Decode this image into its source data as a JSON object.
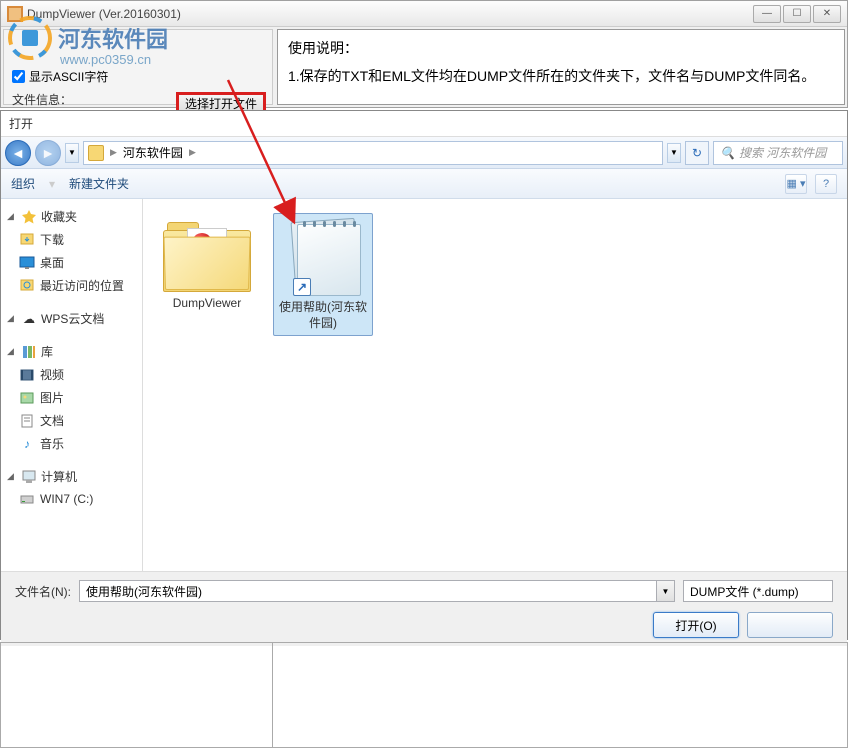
{
  "app": {
    "title": "DumpViewer (Ver.20160301)",
    "checkbox_label": "显示ASCII字符",
    "select_button": "选择打开文件",
    "file_info_label": "文件信息：",
    "instructions_title": "使用说明：",
    "instruction_1": "1.保存的TXT和EML文件均在DUMP文件所在的文件夹下，文件名与DUMP文件同名。"
  },
  "watermark": {
    "site_name": "河东软件园",
    "url": "www.pc0359.cn"
  },
  "dialog": {
    "title": "打开",
    "breadcrumb_root": "河东软件园",
    "search_placeholder": "搜索 河东软件园",
    "toolbar": {
      "organize": "组织",
      "new_folder": "新建文件夹"
    },
    "sidebar": {
      "favorites": "收藏夹",
      "downloads": "下载",
      "desktop": "桌面",
      "recent": "最近访问的位置",
      "wps": "WPS云文档",
      "libraries": "库",
      "videos": "视频",
      "pictures": "图片",
      "documents": "文档",
      "music": "音乐",
      "computer": "计算机",
      "drive_c": "WIN7 (C:)"
    },
    "files": {
      "folder_name": "DumpViewer",
      "file_name": "使用帮助(河东软件园)"
    },
    "footer": {
      "filename_label": "文件名(N):",
      "filename_value": "使用帮助(河东软件园)",
      "filter": "DUMP文件 (*.dump)",
      "open_btn": "打开(O)",
      "cancel_btn": ""
    }
  }
}
